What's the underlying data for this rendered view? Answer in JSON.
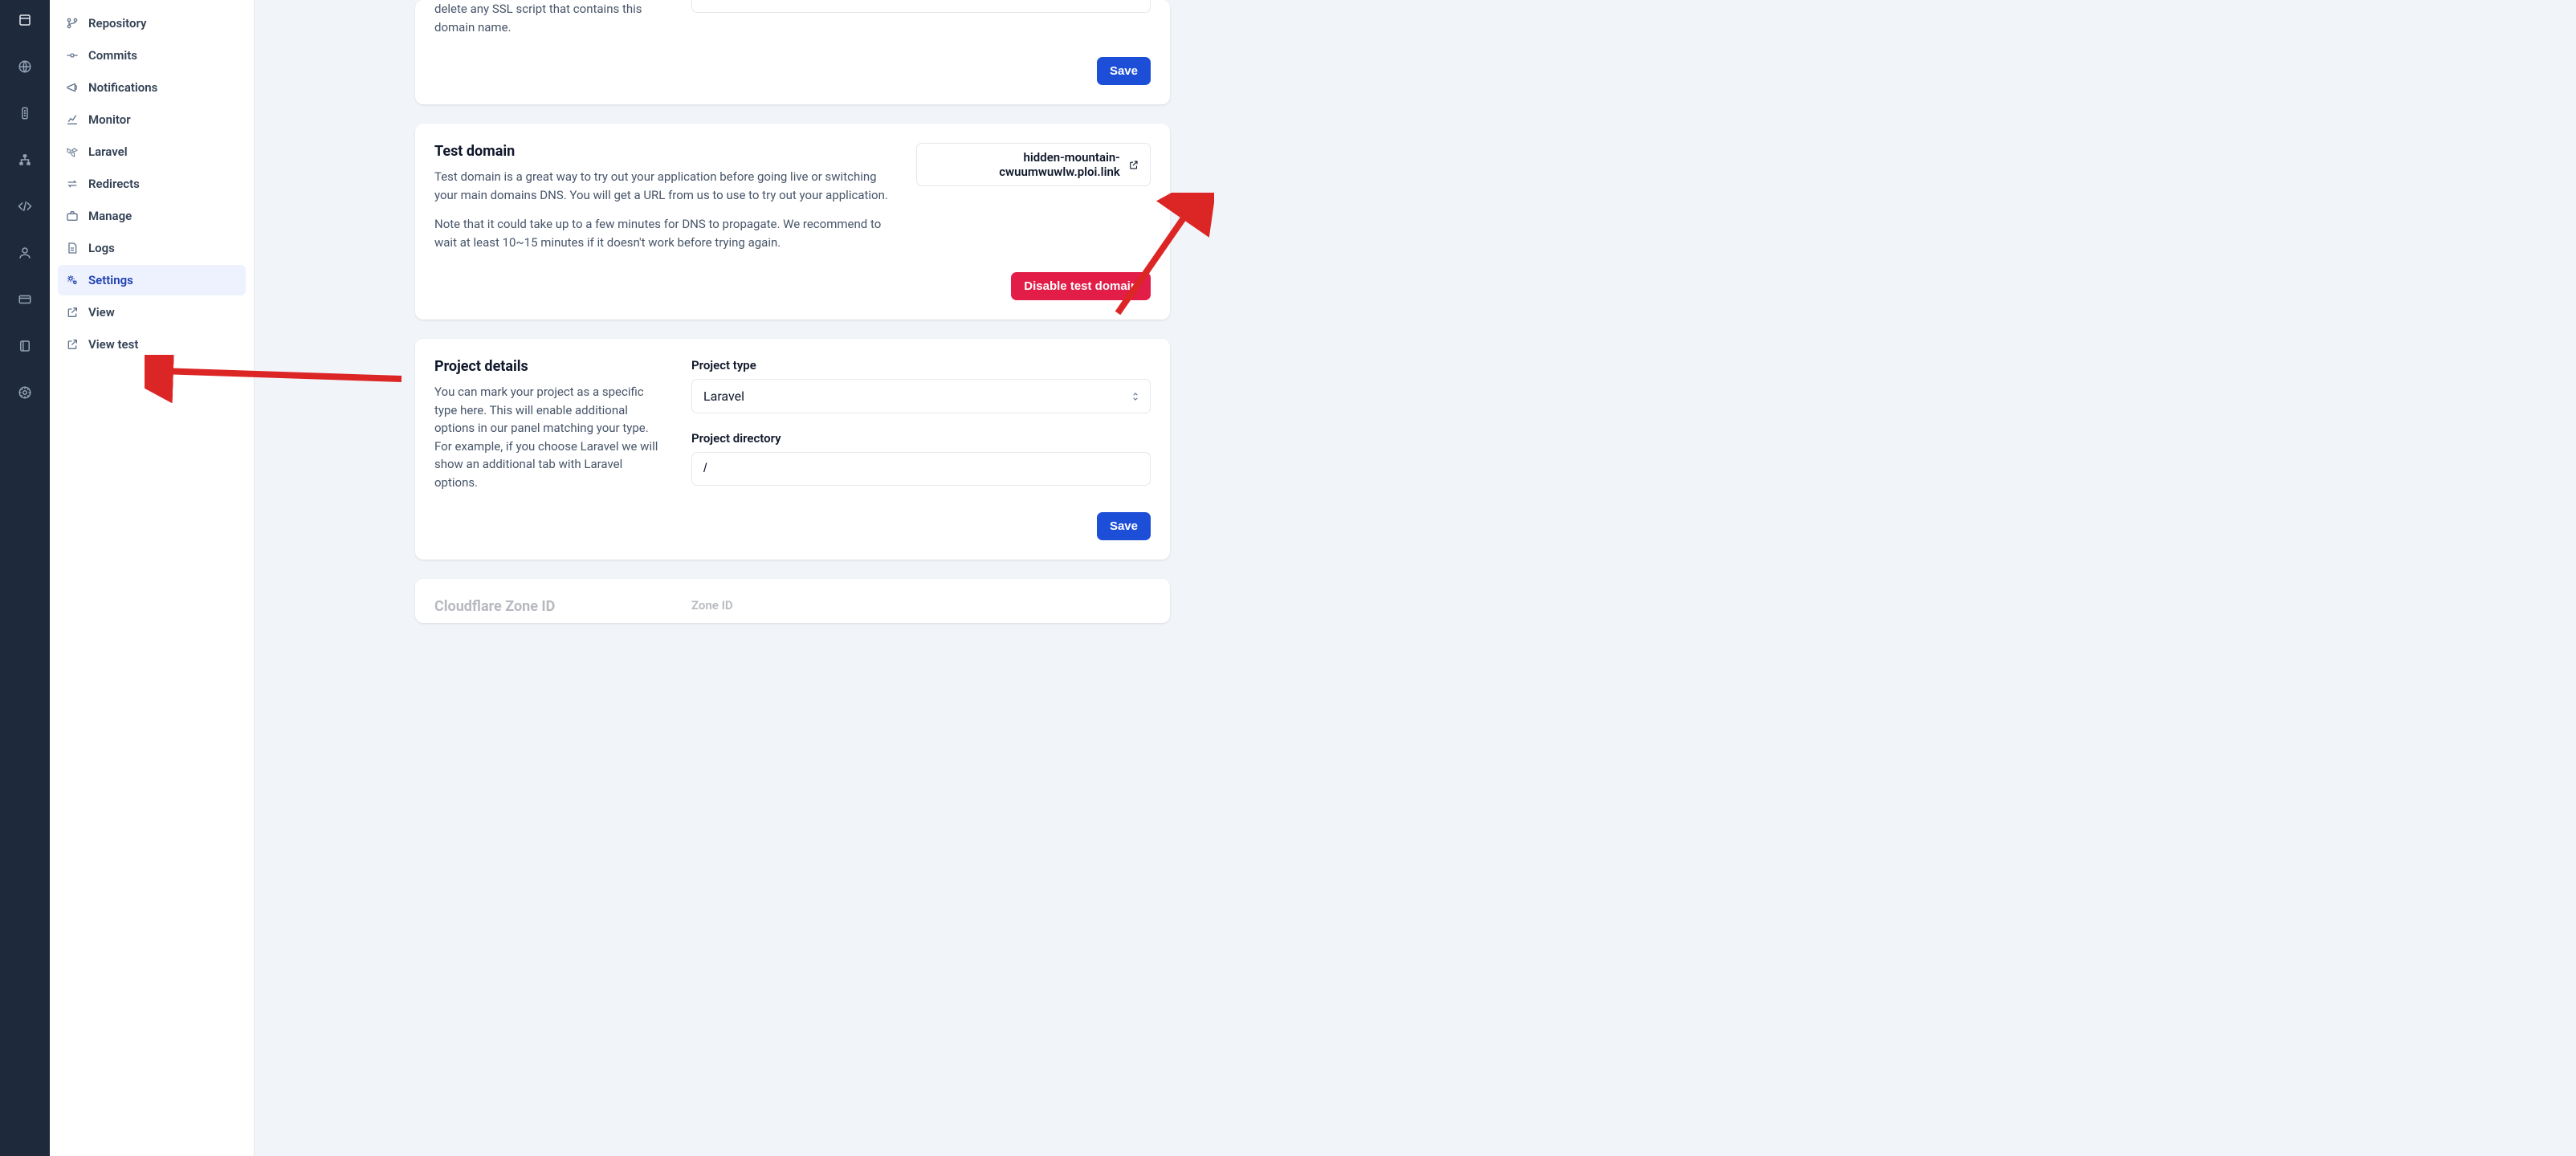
{
  "rail": {
    "items": [
      "home-icon",
      "globe-icon",
      "traffic-icon",
      "network-icon",
      "code-icon",
      "user-icon",
      "card-icon",
      "book-icon",
      "help-icon"
    ]
  },
  "sidebar": {
    "items": [
      {
        "label": "Repository",
        "icon": "git-branch-icon"
      },
      {
        "label": "Commits",
        "icon": "commit-icon"
      },
      {
        "label": "Notifications",
        "icon": "megaphone-icon"
      },
      {
        "label": "Monitor",
        "icon": "chart-line-icon"
      },
      {
        "label": "Laravel",
        "icon": "laravel-icon"
      },
      {
        "label": "Redirects",
        "icon": "arrows-icon"
      },
      {
        "label": "Manage",
        "icon": "briefcase-icon"
      },
      {
        "label": "Logs",
        "icon": "file-icon"
      },
      {
        "label": "Settings",
        "icon": "gears-icon",
        "active": true
      },
      {
        "label": "View",
        "icon": "external-icon"
      },
      {
        "label": "View test",
        "icon": "external-icon"
      }
    ]
  },
  "cards": {
    "ssl": {
      "desc_fragment": "delete any SSL script that contains this domain name.",
      "save": "Save"
    },
    "test_domain": {
      "title": "Test domain",
      "desc": "Test domain is a great way to try out your application before going live or switching your main domains DNS. You will get a URL from us to use to try out your application.",
      "note": "Note that it could take up to a few minutes for DNS to propagate. We recommend to wait at least 10~15 minutes if it doesn't work before trying again.",
      "url": "hidden-mountain-cwuumwuwlw.ploi.link",
      "disable": "Disable test domain"
    },
    "project": {
      "title": "Project details",
      "desc": "You can mark your project as a specific type here. This will enable additional options in our panel matching your type. For example, if you choose Laravel we will show an additional tab with Laravel options.",
      "type_label": "Project type",
      "type_value": "Laravel",
      "dir_label": "Project directory",
      "dir_value": "/",
      "save": "Save"
    },
    "cloudflare": {
      "title": "Cloudflare Zone ID",
      "zone_label": "Zone ID"
    }
  }
}
